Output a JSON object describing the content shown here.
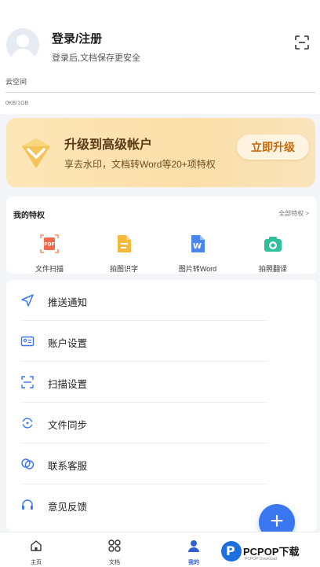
{
  "header": {
    "login_title": "登录/注册",
    "login_subtitle": "登录后,文档保存更安全",
    "cloud_label": "云空间",
    "cloud_usage": "0KB/1GB"
  },
  "vip": {
    "title": "升级到高级帐户",
    "subtitle": "享去水印，文档转Word等20+项特权",
    "button": "立即升级"
  },
  "privileges": {
    "title": "我的特权",
    "all_link": "全部特权 >",
    "items": [
      {
        "label": "文件扫描",
        "icon": "pdf-scan-icon"
      },
      {
        "label": "拍图识字",
        "icon": "text-recognition-icon"
      },
      {
        "label": "图片转Word",
        "icon": "word-icon"
      },
      {
        "label": "拍照翻译",
        "icon": "photo-translate-icon"
      }
    ]
  },
  "menu": [
    {
      "label": "推送通知",
      "icon": "send-icon"
    },
    {
      "label": "账户设置",
      "icon": "id-card-icon"
    },
    {
      "label": "扫描设置",
      "icon": "scan-frame-icon"
    },
    {
      "label": "文件同步",
      "icon": "sync-icon"
    },
    {
      "label": "联系客服",
      "icon": "chat-icon"
    },
    {
      "label": "意见反馈",
      "icon": "headset-icon"
    }
  ],
  "tabs": [
    {
      "label": "主页",
      "icon": "home-icon"
    },
    {
      "label": "文档",
      "icon": "grid-icon"
    },
    {
      "label": "我的",
      "icon": "user-icon",
      "active": true
    }
  ],
  "watermark": {
    "title": "PCPOP下载",
    "subtitle": "PCPOP Download"
  },
  "colors": {
    "accent": "#3a76f0",
    "vip_bg": "#fde6b7",
    "vip_text": "#5a3a14",
    "vip_button_text": "#c66a0e"
  }
}
